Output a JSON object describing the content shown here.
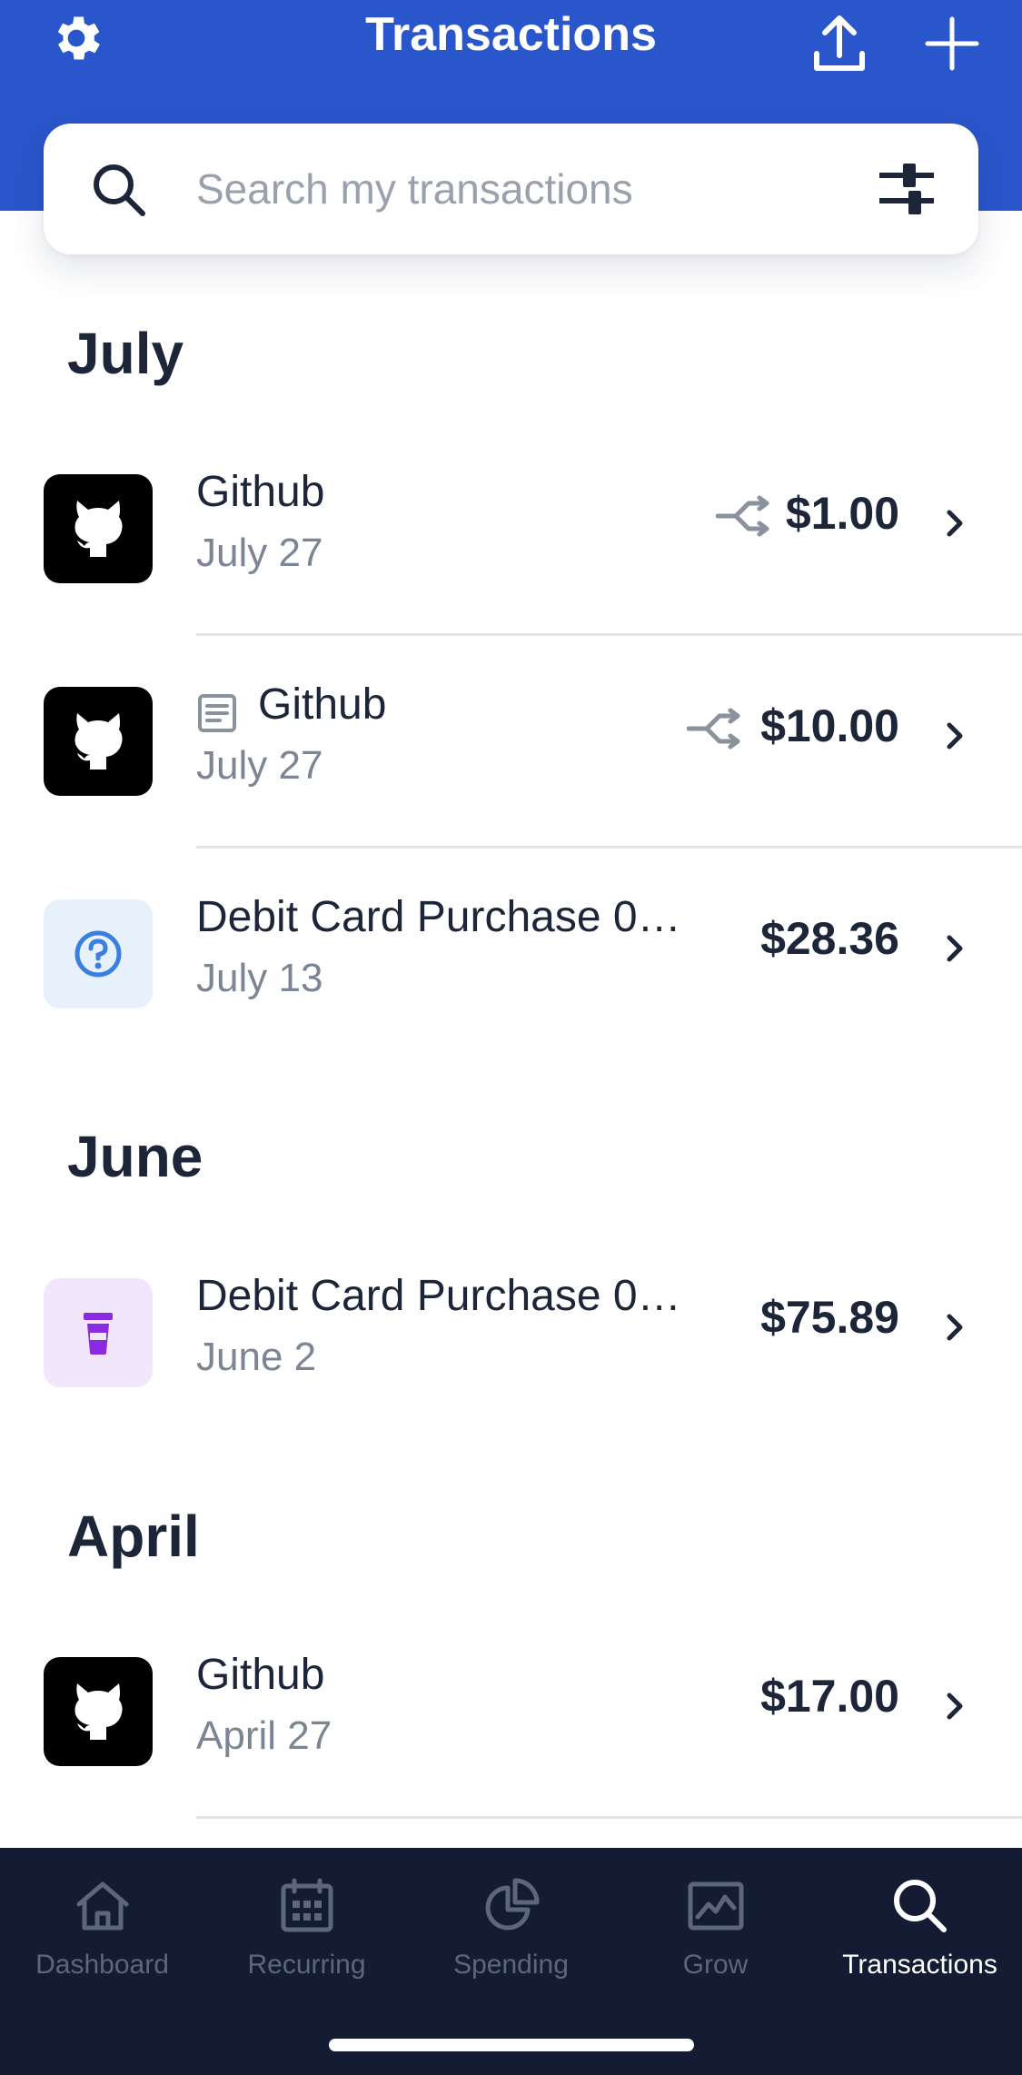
{
  "header": {
    "title": "Transactions",
    "settings_icon": "gear-icon",
    "export_icon": "upload-icon",
    "add_icon": "plus-icon",
    "background": "#2a56cb"
  },
  "search": {
    "placeholder": "Search my transactions",
    "value": "",
    "search_icon": "search-icon",
    "filter_icon": "sliders-icon"
  },
  "sections": [
    {
      "month": "July",
      "transactions": [
        {
          "name": "Github",
          "date": "July 27",
          "amount": "$1.00",
          "logo": "github-logo",
          "split": true,
          "note": false
        },
        {
          "name": "Github",
          "date": "July 27",
          "amount": "$10.00",
          "logo": "github-logo",
          "split": true,
          "note": true
        },
        {
          "name": "Debit Card Purchase 0…",
          "date": "July 13",
          "amount": "$28.36",
          "logo": "question-icon",
          "split": false,
          "note": false
        }
      ]
    },
    {
      "month": "June",
      "transactions": [
        {
          "name": "Debit Card Purchase 0…",
          "date": "June 2",
          "amount": "$75.89",
          "logo": "coffee-cup-icon",
          "split": false,
          "note": false
        }
      ]
    },
    {
      "month": "April",
      "transactions": [
        {
          "name": "Github",
          "date": "April 27",
          "amount": "$17.00",
          "logo": "github-logo",
          "split": false,
          "note": false
        }
      ]
    }
  ],
  "tabbar": {
    "tabs": [
      {
        "label": "Dashboard",
        "icon": "home-icon",
        "active": false
      },
      {
        "label": "Recurring",
        "icon": "calendar-icon",
        "active": false
      },
      {
        "label": "Spending",
        "icon": "pie-chart-icon",
        "active": false
      },
      {
        "label": "Grow",
        "icon": "chart-line-icon",
        "active": false
      },
      {
        "label": "Transactions",
        "icon": "search-icon",
        "active": true
      }
    ]
  },
  "colors": {
    "accent": "#2a56cb",
    "tabbar": "#131c33",
    "text": "#1c2638",
    "muted": "#7c8593"
  }
}
